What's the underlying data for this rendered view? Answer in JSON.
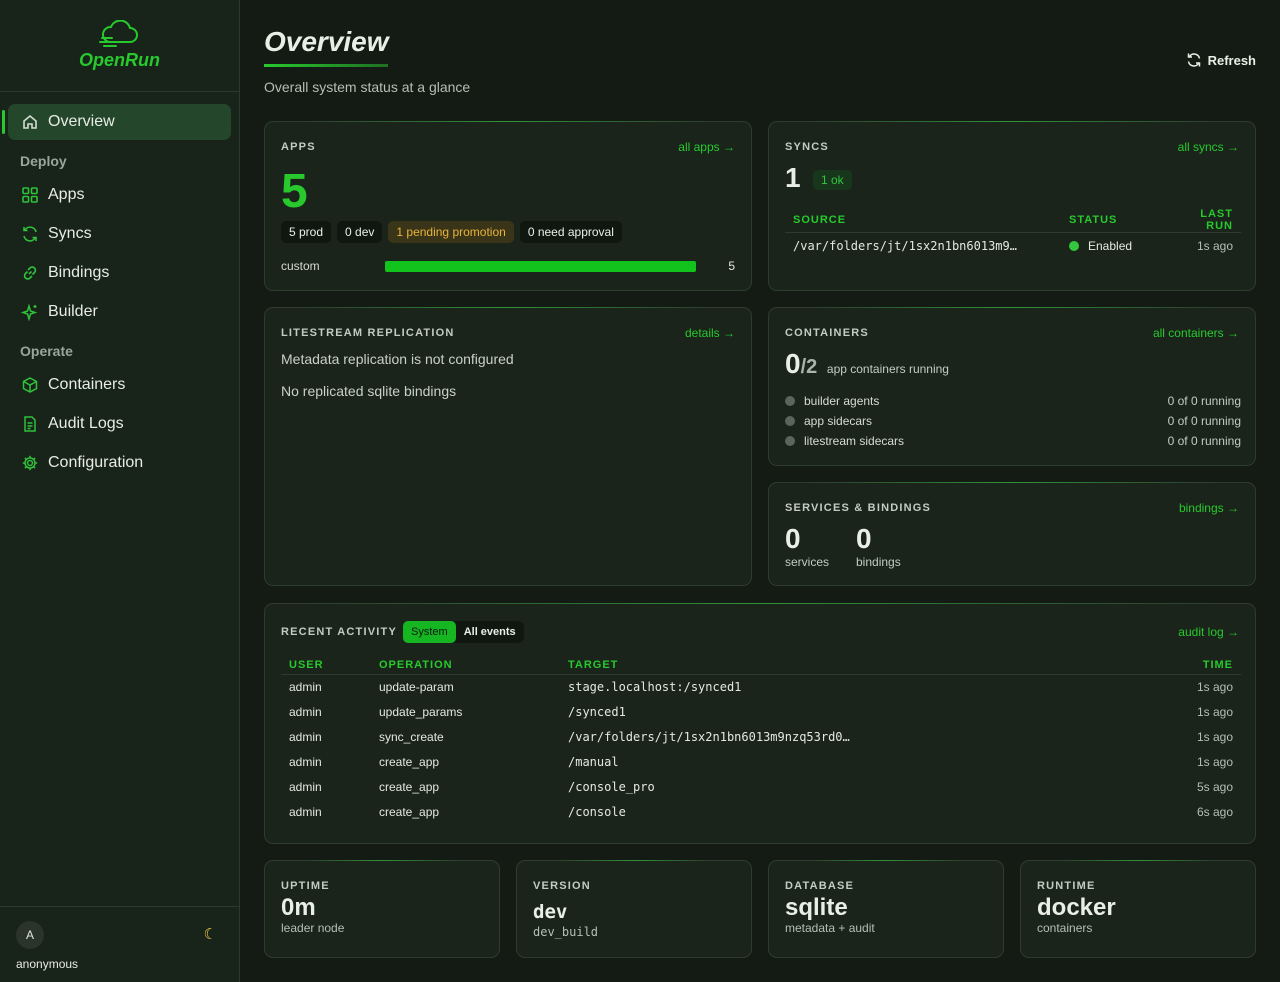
{
  "brand": {
    "name": "OpenRun"
  },
  "sidebar": {
    "items": [
      {
        "label": "Overview",
        "icon": "home-icon",
        "active": true
      },
      {
        "section": "Deploy"
      },
      {
        "label": "Apps",
        "icon": "grid-icon"
      },
      {
        "label": "Syncs",
        "icon": "sync-icon"
      },
      {
        "label": "Bindings",
        "icon": "link-icon"
      },
      {
        "label": "Builder",
        "icon": "sparkle-icon"
      },
      {
        "section": "Operate"
      },
      {
        "label": "Containers",
        "icon": "cube-icon"
      },
      {
        "label": "Audit Logs",
        "icon": "document-icon"
      },
      {
        "label": "Configuration",
        "icon": "gear-icon"
      }
    ],
    "user": {
      "initial": "A",
      "name": "anonymous",
      "theme_icon": "moon-icon"
    }
  },
  "header": {
    "title": "Overview",
    "subtitle": "Overall system status at a glance",
    "refresh_label": "Refresh"
  },
  "apps": {
    "label": "APPS",
    "link": "all apps →",
    "count": "5",
    "pills": [
      "5 prod",
      "0 dev",
      "1 pending promotion",
      "0 need approval"
    ],
    "bar": {
      "label": "custom",
      "value": "5",
      "fraction": 1.0
    }
  },
  "syncs": {
    "label": "SYNCS",
    "link": "all syncs →",
    "count": "1",
    "badge": "1 ok",
    "columns": [
      "SOURCE",
      "STATUS",
      "LAST RUN"
    ],
    "rows": [
      {
        "source": "/var/folders/jt/1sx2n1bn6013m9…",
        "status": "Enabled",
        "last_run": "1s ago"
      }
    ]
  },
  "litestream": {
    "label": "LITESTREAM REPLICATION",
    "link": "details →",
    "line1": "Metadata replication is not configured",
    "line2": "No replicated sqlite bindings"
  },
  "containers": {
    "label": "CONTAINERS",
    "link": "all containers →",
    "running": "0",
    "total": "/2",
    "caption": "app containers running",
    "rows": [
      {
        "name": "builder agents",
        "value": "0 of 0 running"
      },
      {
        "name": "app sidecars",
        "value": "0 of 0 running"
      },
      {
        "name": "litestream sidecars",
        "value": "0 of 0 running"
      }
    ]
  },
  "services": {
    "label": "SERVICES & BINDINGS",
    "link": "bindings →",
    "services_count": "0",
    "services_label": "services",
    "bindings_count": "0",
    "bindings_label": "bindings"
  },
  "activity": {
    "label": "RECENT ACTIVITY",
    "tabs": [
      "System",
      "All events"
    ],
    "link": "audit log →",
    "columns": [
      "USER",
      "OPERATION",
      "TARGET",
      "TIME"
    ],
    "rows": [
      {
        "user": "admin",
        "op": "update-param",
        "target": "stage.localhost:/synced1",
        "time": "1s ago"
      },
      {
        "user": "admin",
        "op": "update_params",
        "target": "/synced1",
        "time": "1s ago"
      },
      {
        "user": "admin",
        "op": "sync_create",
        "target": "/var/folders/jt/1sx2n1bn6013m9nzq53rd0…",
        "time": "1s ago"
      },
      {
        "user": "admin",
        "op": "create_app",
        "target": "/manual",
        "time": "1s ago"
      },
      {
        "user": "admin",
        "op": "create_app",
        "target": "/console_pro",
        "time": "5s ago"
      },
      {
        "user": "admin",
        "op": "create_app",
        "target": "/console",
        "time": "6s ago"
      }
    ]
  },
  "stats": [
    {
      "label": "UPTIME",
      "value": "0m",
      "sub": "leader node"
    },
    {
      "label": "VERSION",
      "value": "dev",
      "sub": "dev_build"
    },
    {
      "label": "DATABASE",
      "value": "sqlite",
      "sub": "metadata + audit"
    },
    {
      "label": "RUNTIME",
      "value": "docker",
      "sub": "containers"
    }
  ],
  "colors": {
    "accent": "#27c92d",
    "background": "#131b14",
    "card": "#1a241b",
    "warn": "#e8b43c"
  }
}
